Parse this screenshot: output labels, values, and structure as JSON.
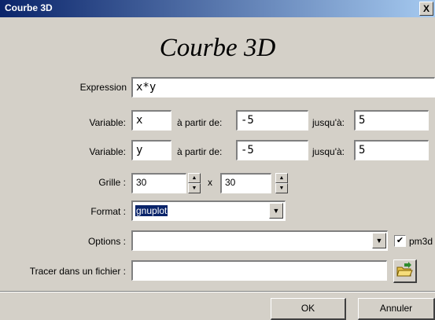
{
  "window": {
    "title": "Courbe 3D",
    "close_glyph": "X"
  },
  "heading": "Courbe 3D",
  "expression": {
    "label": "Expression",
    "value": "x*y"
  },
  "variable1": {
    "label": "Variable:",
    "name": "x",
    "from_label": "à partir de:",
    "from": "-5",
    "to_label": "jusqu'à:",
    "to": "5"
  },
  "variable2": {
    "label": "Variable:",
    "name": "y",
    "from_label": "à partir de:",
    "from": "-5",
    "to_label": "jusqu'à:",
    "to": "5"
  },
  "grid": {
    "label": "Grille :",
    "nx": "30",
    "times": "x",
    "ny": "30"
  },
  "format": {
    "label": "Format :",
    "value": "gnuplot"
  },
  "options": {
    "label": "Options :",
    "value": "",
    "checkbox_label": "pm3d",
    "checked": true,
    "check_glyph": "✔"
  },
  "file": {
    "label": "Tracer dans un fichier :",
    "value": "",
    "icon": "folder-open-icon"
  },
  "buttons": {
    "ok": "OK",
    "cancel": "Annuler"
  },
  "colors": {
    "titlebar_start": "#0a246a",
    "titlebar_end": "#a6caf0",
    "face": "#d4d0c8",
    "selection": "#0a246a"
  }
}
